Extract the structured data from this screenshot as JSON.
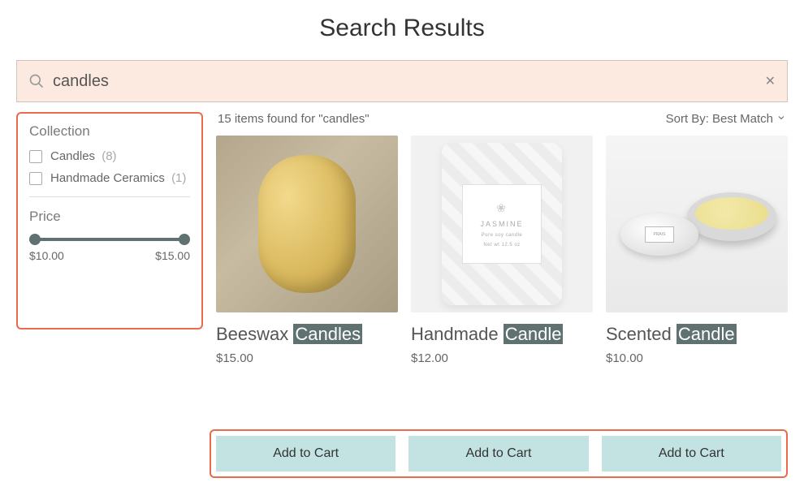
{
  "page_title": "Search Results",
  "search": {
    "value": "candles"
  },
  "filters": {
    "collection_heading": "Collection",
    "options": [
      {
        "label": "Candles",
        "count": "(8)"
      },
      {
        "label": "Handmade Ceramics",
        "count": "(1)"
      }
    ],
    "price_heading": "Price",
    "price_min": "$10.00",
    "price_max": "$15.00"
  },
  "results": {
    "count_text": "15 items found for \"candles\"",
    "sort_label": "Sort By:",
    "sort_value": "Best Match"
  },
  "products": [
    {
      "prefix": "Beeswax ",
      "highlight": "Candles",
      "suffix": "",
      "price": "$15.00",
      "cart_label": "Add to Cart"
    },
    {
      "prefix": "Handmade ",
      "highlight": "Candle",
      "suffix": "",
      "price": "$12.00",
      "cart_label": "Add to Cart"
    },
    {
      "prefix": "Scented ",
      "highlight": "Candle",
      "suffix": "",
      "price": "$10.00",
      "cart_label": "Add to Cart"
    }
  ],
  "jasmine_label": {
    "brand": "JASMINE",
    "sub": "Pure soy candle",
    "sub2": "Net wt 12.5 oz"
  }
}
